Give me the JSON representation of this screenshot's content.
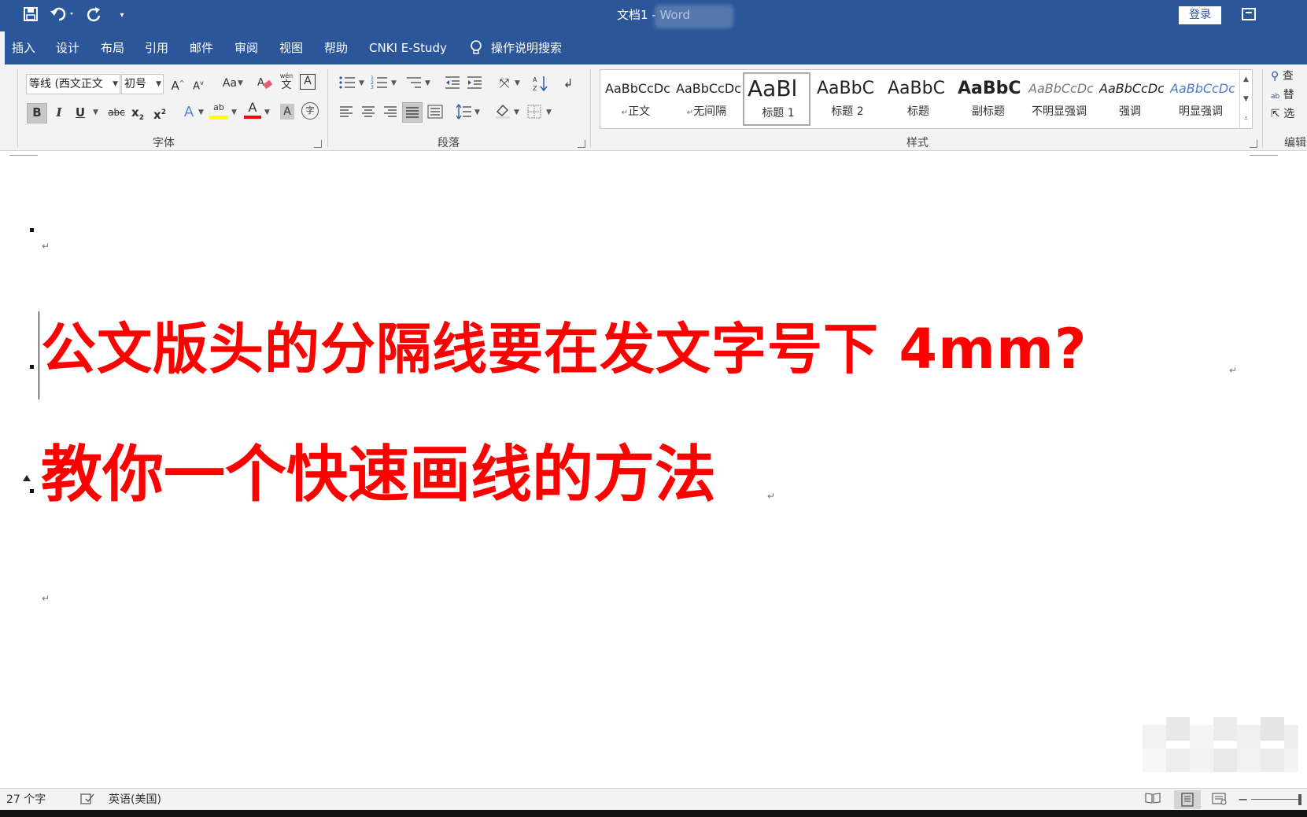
{
  "titlebar": {
    "title": "文档1  -  Word",
    "login": "登录",
    "save_icon": "save-icon",
    "undo_icon": "undo-icon",
    "redo_icon": "redo-icon",
    "customize_icon": "customize-qat-icon"
  },
  "tabs": [
    "插入",
    "设计",
    "布局",
    "引用",
    "邮件",
    "审阅",
    "视图",
    "帮助",
    "CNKI E-Study",
    "操作说明搜索"
  ],
  "font_group": {
    "label": "字体",
    "font_name": "等线 (西文正文",
    "font_size": "初号",
    "grow": "A",
    "shrink": "A",
    "change_case": "Aa",
    "phonetic_top": "wén",
    "phonetic_bottom": "文",
    "char_border": "A",
    "bold": "B",
    "italic": "I",
    "underline": "U",
    "strike": "abc",
    "subscript": "x",
    "superscript": "x",
    "text_effect": "A",
    "highlight": "ab",
    "font_color": "A",
    "shading": "A",
    "enclose": "字"
  },
  "paragraph_group": {
    "label": "段落"
  },
  "styles_group": {
    "label": "样式",
    "items": [
      {
        "sample": "AaBbCcDc",
        "name": "正文",
        "mark": "↵"
      },
      {
        "sample": "AaBbCcDc",
        "name": "无间隔",
        "mark": "↵"
      },
      {
        "sample": "AaBl",
        "name": "标题 1",
        "mark": ""
      },
      {
        "sample": "AaBbC",
        "name": "标题 2",
        "mark": ""
      },
      {
        "sample": "AaBbC",
        "name": "标题",
        "mark": ""
      },
      {
        "sample": "AaBbC",
        "name": "副标题",
        "mark": ""
      },
      {
        "sample": "AaBbCcDc",
        "name": "不明显强调",
        "mark": ""
      },
      {
        "sample": "AaBbCcDc",
        "name": "强调",
        "mark": ""
      },
      {
        "sample": "AaBbCcDc",
        "name": "明显强调",
        "mark": ""
      }
    ]
  },
  "editing_group": {
    "label": "编辑",
    "find": "查",
    "replace": "替",
    "select": "选",
    "replace_icon_text": "ab"
  },
  "document": {
    "paragraph_mark": "↵",
    "line1": "公文版头的分隔线要在发文字号下 4mm?",
    "line2": "教你一个快速画线的方法"
  },
  "status": {
    "word_count": "27 个字",
    "language": "英语(美国)"
  },
  "colors": {
    "accent": "#2b579a",
    "heading_text": "#ff0000",
    "ribbon_bg": "#f3f3f3"
  }
}
